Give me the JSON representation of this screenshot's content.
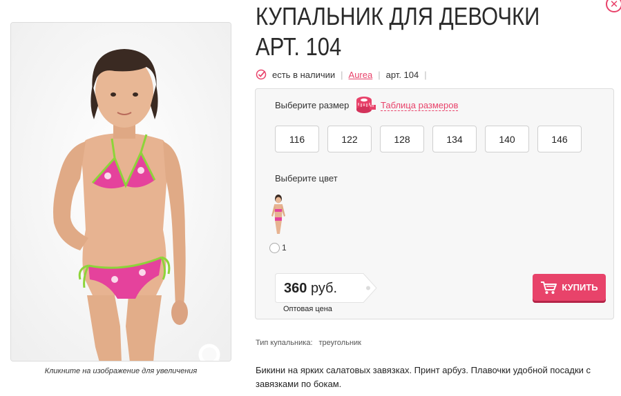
{
  "product": {
    "title": "КУПАЛЬНИК ДЛЯ ДЕВОЧКИ АРТ. 104",
    "availability": "есть в наличии",
    "brand": "Aurea",
    "article": "арт. 104"
  },
  "image": {
    "caption": "Кликните на изображение для увеличения"
  },
  "options": {
    "size_label": "Выберите размер",
    "size_chart_label": "Таблица размеров",
    "sizes": [
      "116",
      "122",
      "128",
      "134",
      "140",
      "146"
    ],
    "color_label": "Выберите цвет",
    "color_option_number": "1"
  },
  "price": {
    "amount": "360",
    "currency": "руб.",
    "note": "Оптовая цена"
  },
  "buy_label": "КУПИТЬ",
  "attributes": {
    "swimsuit_type_label": "Тип купальника:",
    "swimsuit_type_value": "треугольник"
  },
  "description": "Бикини на ярких салатовых завязках. Принт арбуз. Плавочки удобной посадки с завязками по бокам.",
  "colors": {
    "accent": "#e8426a",
    "bikini_pink": "#e5429c",
    "tie_green": "#8dd43a"
  },
  "icons": {
    "close": "close-icon",
    "zoom": "magnifier-icon",
    "availability": "check-circle-icon",
    "size_chart": "measuring-tape-icon",
    "buy": "shopping-cart-icon"
  }
}
